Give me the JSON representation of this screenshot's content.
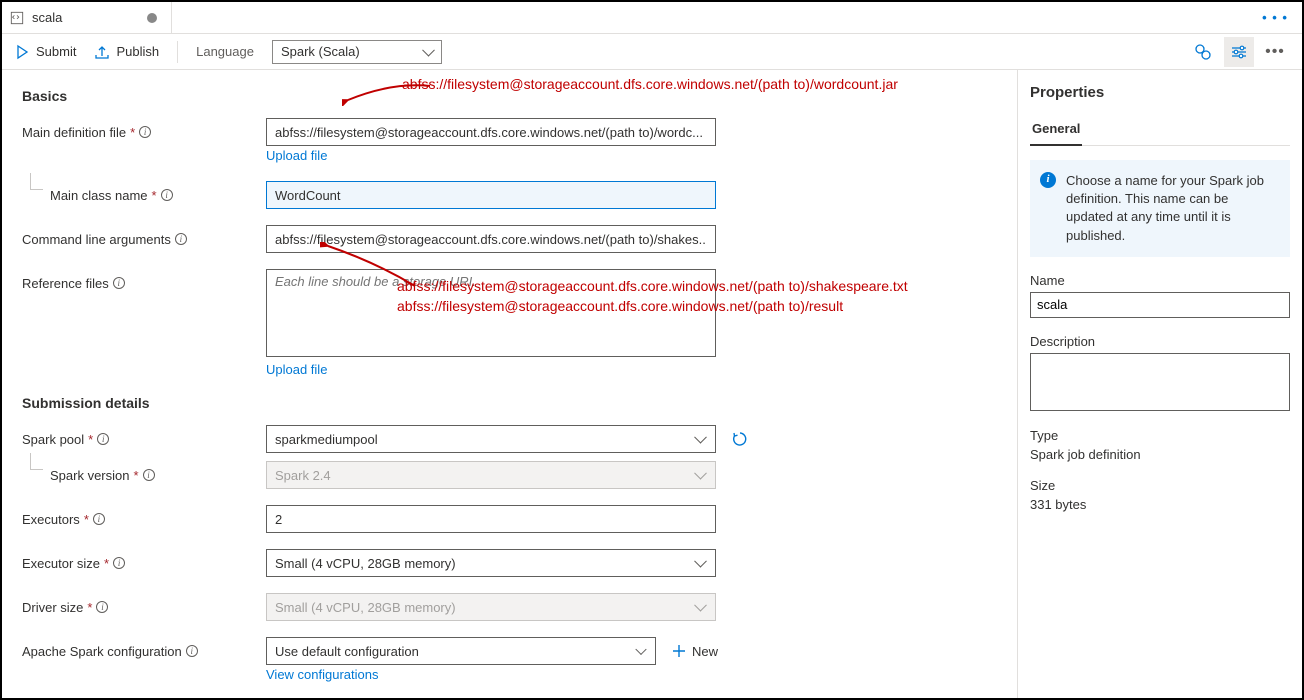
{
  "tab": {
    "title": "scala"
  },
  "toolbar": {
    "submit": "Submit",
    "publish": "Publish",
    "language_label": "Language",
    "language_value": "Spark (Scala)"
  },
  "sections": {
    "basics": "Basics",
    "submission": "Submission details"
  },
  "labels": {
    "main_def": "Main definition file",
    "main_class": "Main class name",
    "cmd_args": "Command line arguments",
    "ref_files": "Reference files",
    "upload_file": "Upload file",
    "spark_pool": "Spark pool",
    "spark_version": "Spark version",
    "executors": "Executors",
    "executor_size": "Executor size",
    "driver_size": "Driver size",
    "spark_config": "Apache Spark configuration",
    "new": "New",
    "view_config": "View configurations"
  },
  "values": {
    "main_def": "abfss://filesystem@storageaccount.dfs.core.windows.net/(path to)/wordc...",
    "main_class": "WordCount",
    "cmd_args": "abfss://filesystem@storageaccount.dfs.core.windows.net/(path to)/shakes...",
    "ref_placeholder": "Each line should be a storage URI.",
    "spark_pool": "sparkmediumpool",
    "spark_version": "Spark 2.4",
    "executors": "2",
    "executor_size": "Small (4 vCPU, 28GB memory)",
    "driver_size": "Small (4 vCPU, 28GB memory)",
    "spark_config": "Use default configuration"
  },
  "annotations": {
    "a1": "abfss://filesystem@storageaccount.dfs.core.windows.net/(path to)/wordcount.jar",
    "a2": "abfss://filesystem@storageaccount.dfs.core.windows.net/(path to)/shakespeare.txt",
    "a3": "abfss://filesystem@storageaccount.dfs.core.windows.net/(path to)/result"
  },
  "properties": {
    "title": "Properties",
    "tab_general": "General",
    "info_text": "Choose a name for your Spark job definition. This name can be updated at any time until it is published.",
    "name_label": "Name",
    "name_value": "scala",
    "desc_label": "Description",
    "type_label": "Type",
    "type_value": "Spark job definition",
    "size_label": "Size",
    "size_value": "331 bytes"
  }
}
